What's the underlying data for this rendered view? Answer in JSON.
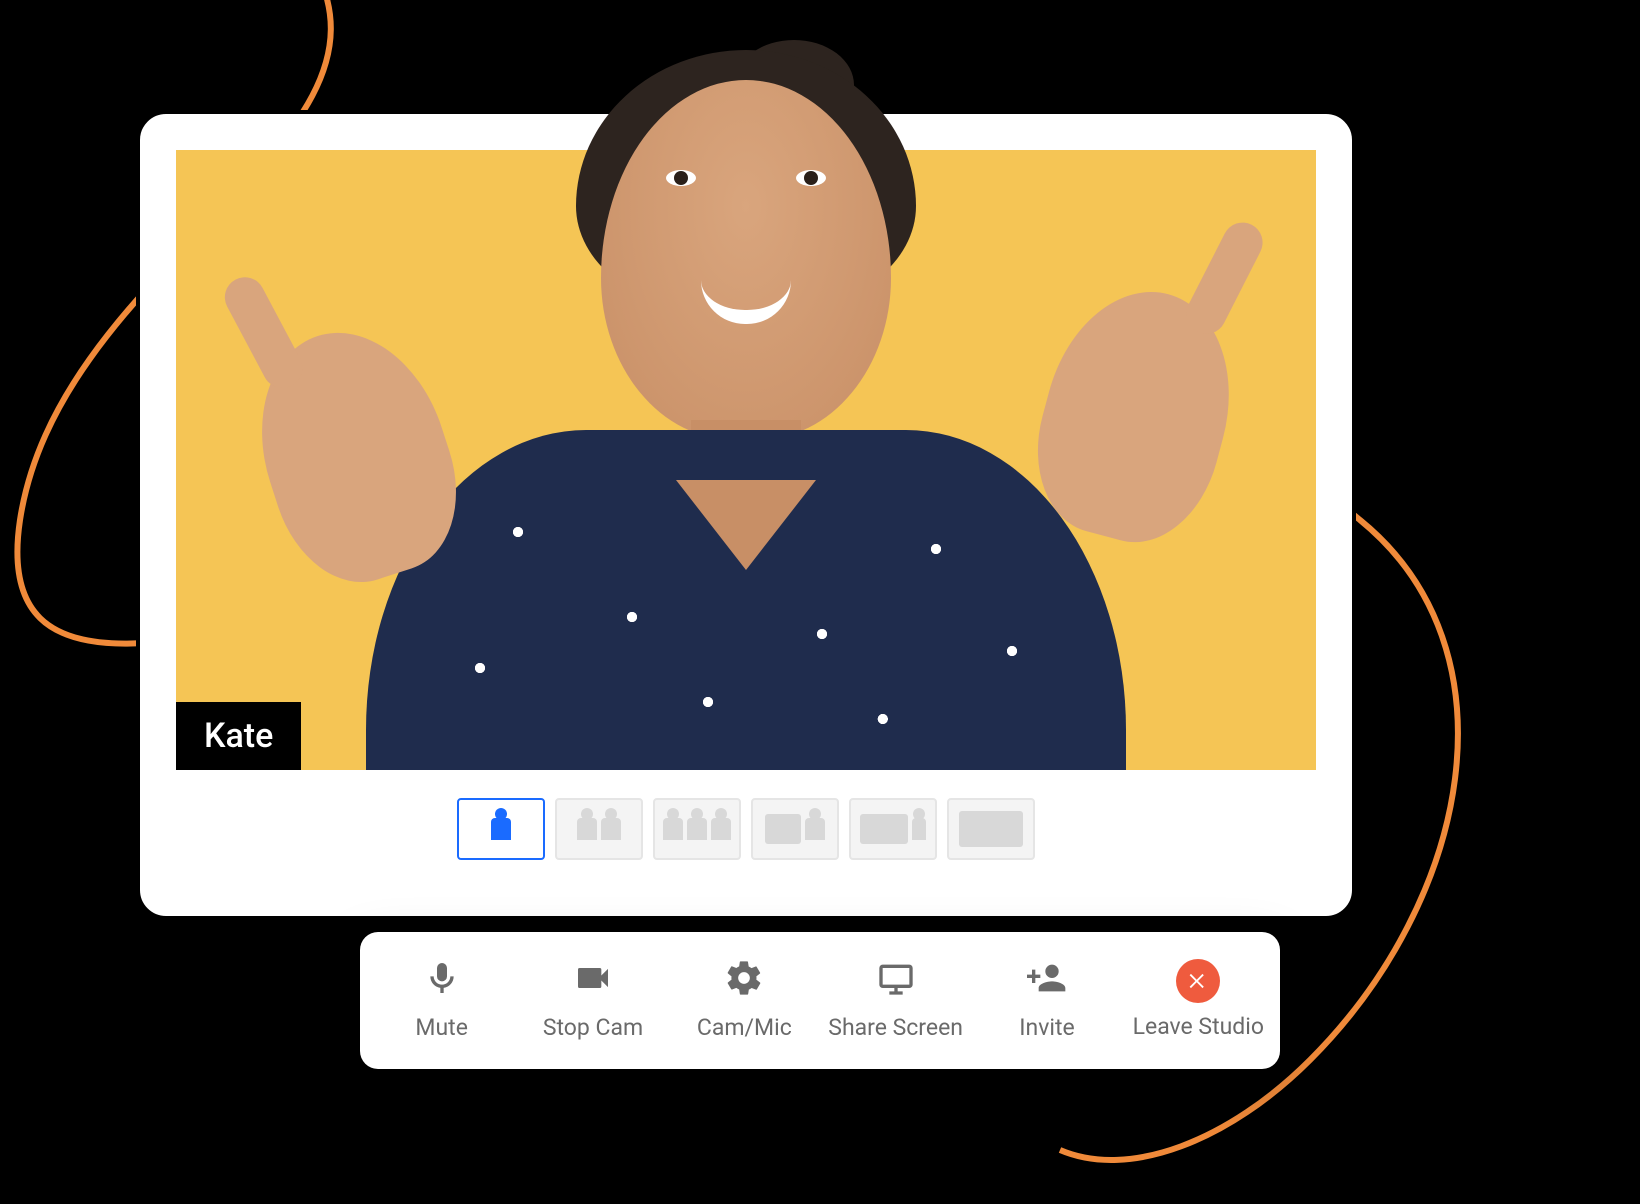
{
  "participant": {
    "name": "Kate"
  },
  "colors": {
    "video_bg": "#f5c555",
    "accent": "#1a6bff",
    "leave": "#ef5b3e",
    "swoosh": "#f08a3a"
  },
  "layouts": {
    "active_index": 0,
    "options": [
      {
        "id": "single-speaker"
      },
      {
        "id": "two-up"
      },
      {
        "id": "three-up"
      },
      {
        "id": "pip-speaker"
      },
      {
        "id": "pip-wide"
      },
      {
        "id": "full-wide"
      }
    ]
  },
  "toolbar": {
    "mute": {
      "label": "Mute",
      "icon": "microphone-icon"
    },
    "stop_cam": {
      "label": "Stop Cam",
      "icon": "camera-icon"
    },
    "cam_mic": {
      "label": "Cam/Mic",
      "icon": "gear-icon"
    },
    "share": {
      "label": "Share Screen",
      "icon": "monitor-icon"
    },
    "invite": {
      "label": "Invite",
      "icon": "person-plus-icon"
    },
    "leave": {
      "label": "Leave Studio",
      "icon": "close-icon"
    }
  }
}
